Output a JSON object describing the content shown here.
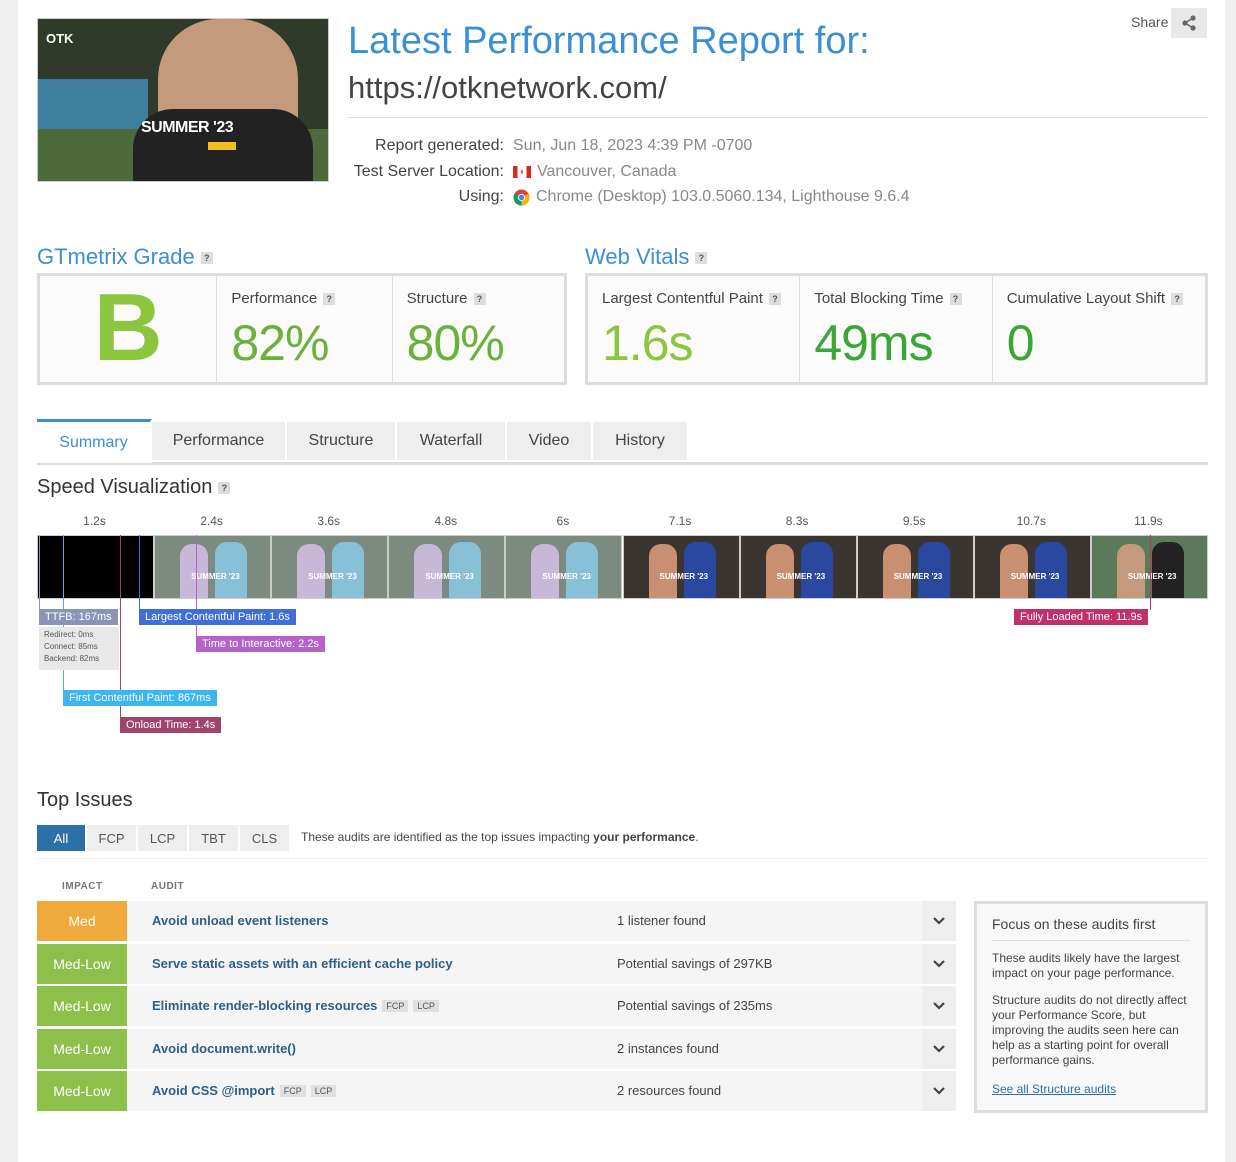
{
  "header": {
    "title": "Latest Performance Report for:",
    "url": "https://otknetwork.com/",
    "share_label": "Share",
    "screenshot": {
      "logo": "OTK",
      "headline": "SUMMER '23"
    },
    "meta": [
      {
        "label": "Report generated:",
        "value": "Sun, Jun 18, 2023 4:39 PM -0700",
        "icon": ""
      },
      {
        "label": "Test Server Location:",
        "value": "Vancouver, Canada",
        "icon": "canada-flag-icon"
      },
      {
        "label": "Using:",
        "value": "Chrome (Desktop) 103.0.5060.134, Lighthouse 9.6.4",
        "icon": "chrome-icon"
      }
    ]
  },
  "grade": {
    "title": "GTmetrix Grade",
    "letter": "B",
    "performance_label": "Performance",
    "performance_value": "82%",
    "structure_label": "Structure",
    "structure_value": "80%"
  },
  "vitals": {
    "title": "Web Vitals",
    "lcp_label": "Largest Contentful Paint",
    "lcp_value": "1.6s",
    "tbt_label": "Total Blocking Time",
    "tbt_value": "49ms",
    "cls_label": "Cumulative Layout Shift",
    "cls_value": "0"
  },
  "tabs": [
    "Summary",
    "Performance",
    "Structure",
    "Waterfall",
    "Video",
    "History"
  ],
  "speed_viz": {
    "title": "Speed Visualization",
    "frame_times": [
      "1.2s",
      "2.4s",
      "3.6s",
      "4.8s",
      "6s",
      "7.1s",
      "8.3s",
      "9.5s",
      "10.7s",
      "11.9s"
    ],
    "markers": {
      "ttfb": "TTFB: 167ms",
      "redirect": "Redirect: 0ms",
      "connect": "Connect: 85ms",
      "backend": "Backend: 82ms",
      "lcp": "Largest Contentful Paint: 1.6s",
      "tti": "Time to Interactive: 2.2s",
      "fcp": "First Contentful Paint: 867ms",
      "onload": "Onload Time: 1.4s",
      "fully_loaded": "Fully Loaded Time: 11.9s"
    },
    "frame_overlay_text": "SUMMER '23"
  },
  "top_issues": {
    "title": "Top Issues",
    "filters": [
      "All",
      "FCP",
      "LCP",
      "TBT",
      "CLS"
    ],
    "desc_prefix": "These audits are identified as the top issues impacting ",
    "desc_bold": "your performance",
    "desc_suffix": ".",
    "col_impact": "IMPACT",
    "col_audit": "AUDIT",
    "rows": [
      {
        "impact": "Med",
        "audit": "Avoid unload event listeners",
        "tags": [],
        "result": "1 listener found"
      },
      {
        "impact": "Med-Low",
        "audit": "Serve static assets with an efficient cache policy",
        "tags": [],
        "result": "Potential savings of 297KB"
      },
      {
        "impact": "Med-Low",
        "audit": "Eliminate render-blocking resources",
        "tags": [
          "FCP",
          "LCP"
        ],
        "result": "Potential savings of 235ms"
      },
      {
        "impact": "Med-Low",
        "audit": "Avoid document.write()",
        "tags": [],
        "result": "2 instances found"
      },
      {
        "impact": "Med-Low",
        "audit": "Avoid CSS @import",
        "tags": [
          "FCP",
          "LCP"
        ],
        "result": "2 resources found"
      }
    ],
    "focus": {
      "title": "Focus on these audits first",
      "p1": "These audits likely have the largest impact on your page performance.",
      "p2": "Structure audits do not directly affect your Performance Score, but improving the audits seen here can help as a starting point for overall performance gains.",
      "link": "See all Structure audits"
    }
  },
  "colors": {
    "accent": "#3a8fd6",
    "grade_green": "#8cc63f",
    "impact_med": "#f0a93b",
    "impact_medlow": "#8cc04a",
    "ttfb": "#8a93b8",
    "lcp": "#3f6fd6",
    "tti": "#b462c8",
    "fcp": "#3db5f0",
    "onload": "#a0446e",
    "fully_loaded": "#c0306a"
  }
}
